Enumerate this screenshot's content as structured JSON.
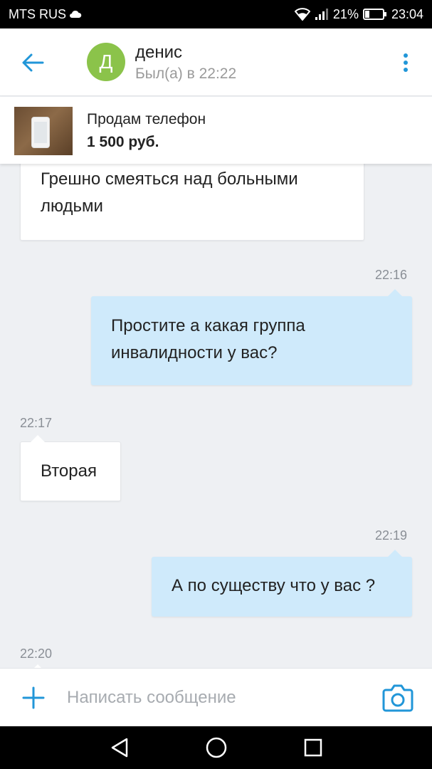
{
  "status_bar": {
    "carrier": "MTS RUS",
    "battery": "21%",
    "time": "23:04",
    "icons": [
      "cloud-icon",
      "wifi-icon",
      "signal-icon",
      "battery-icon"
    ]
  },
  "header": {
    "avatar_letter": "Д",
    "avatar_color": "#8bc34a",
    "contact_name": "денис",
    "contact_status": "Был(а) в 22:22",
    "accent": "#2196d8"
  },
  "listing": {
    "title": "Продам телефон",
    "price": "1 500 руб."
  },
  "messages": [
    {
      "direction": "incoming",
      "text_lines": [
        "Грешно смеяться над больными",
        "людьми"
      ],
      "time": ""
    },
    {
      "direction": "outgoing",
      "text_lines": [
        "Простите а какая группа",
        "инвалидности у вас?"
      ],
      "time": "22:16"
    },
    {
      "direction": "incoming",
      "text_lines": [
        "Вторая"
      ],
      "time": "22:17"
    },
    {
      "direction": "outgoing",
      "text_lines": [
        "А по существу что у вас ?"
      ],
      "time": "22:19"
    },
    {
      "direction": "incoming",
      "text_lines": [],
      "time": "22:20"
    }
  ],
  "input": {
    "placeholder": "Написать сообщение",
    "value": ""
  },
  "nav": [
    "back-triangle-icon",
    "home-circle-icon",
    "recents-square-icon"
  ]
}
